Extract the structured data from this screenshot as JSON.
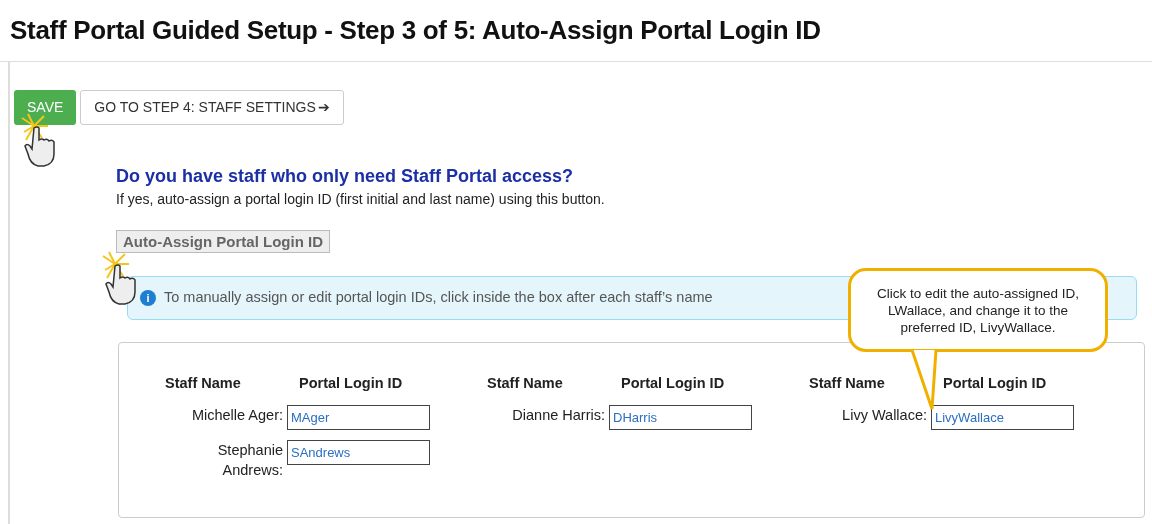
{
  "title": "Staff Portal Guided Setup - Step 3 of 5: Auto-Assign Portal Login ID",
  "buttons": [
    {
      "kind": "primary",
      "label": "SAVE"
    },
    {
      "kind": "secondary",
      "label": "GO TO STEP 4: STAFF SETTINGS",
      "arrow": "➔"
    }
  ],
  "section": {
    "heading": "Do you have staff who only need Staff Portal access?",
    "description": "If yes, auto-assign a portal login ID (first initial and last name) using this button.",
    "button": "Auto-Assign Portal Login ID"
  },
  "info": {
    "icon": "i",
    "text": "To manually assign or edit portal login IDs, click inside the box after each staff’s name"
  },
  "callout": {
    "text": "Click to edit the auto-assigned ID, LWallace, and change it to the preferred ID, LivyWallace."
  },
  "staff_columns": [
    {
      "name_header": "Staff Name",
      "id_header": "Portal Login ID",
      "entries": [
        {
          "name": "Michelle Ager:",
          "login_id": "MAger"
        },
        {
          "name": "Stephanie Andrews:",
          "login_id": "SAndrews"
        }
      ]
    },
    {
      "name_header": "Staff Name",
      "id_header": "Portal Login ID",
      "entries": [
        {
          "name": "Dianne Harris:",
          "login_id": "DHarris"
        }
      ]
    },
    {
      "name_header": "Staff Name",
      "id_header": "Portal Login ID",
      "entries": [
        {
          "name": "Livy Wallace:",
          "login_id": "LivyWallace"
        }
      ]
    }
  ]
}
